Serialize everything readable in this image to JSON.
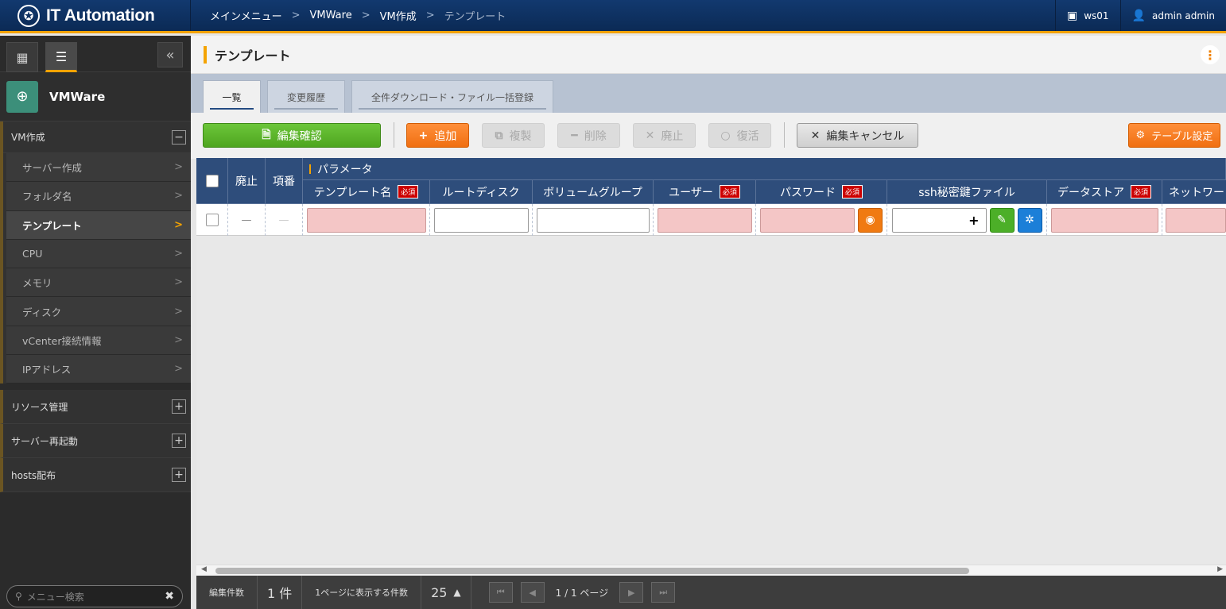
{
  "header": {
    "logo_text": "IT Automation",
    "breadcrumb": [
      "メインメニュー",
      "VMWare",
      "VM作成",
      "テンプレート"
    ],
    "workspace": "ws01",
    "user": "admin admin"
  },
  "sidebar": {
    "menu_title": "VMWare",
    "open_group": {
      "label": "VM作成",
      "items": [
        "サーバー作成",
        "フォルダ名",
        "テンプレート",
        "CPU",
        "メモリ",
        "ディスク",
        "vCenter接続情報",
        "IPアドレス"
      ]
    },
    "collapsed_groups": [
      "リソース管理",
      "サーバー再起動",
      "hosts配布"
    ],
    "search_placeholder": "メニュー検索"
  },
  "page": {
    "title": "テンプレート",
    "tabs": [
      "一覧",
      "変更履歴",
      "全件ダウンロード・ファイル一括登録"
    ]
  },
  "toolbar": {
    "confirm": "編集確認",
    "add": "追加",
    "copy": "複製",
    "delete": "削除",
    "discard": "廃止",
    "restore": "復活",
    "cancel_edit": "編集キャンセル",
    "table_settings": "テーブル設定"
  },
  "table": {
    "col_discard": "廃止",
    "col_no": "項番",
    "group_label": "パラメータ",
    "required_badge": "必須",
    "columns": [
      "テンプレート名",
      "ルートディスク",
      "ボリュームグループ",
      "ユーザー",
      "パスワード",
      "ssh秘密鍵ファイル",
      "データストア",
      "ネットワー"
    ],
    "row_dash": "—"
  },
  "footer": {
    "edit_count_label": "編集件数",
    "edit_count_value": "1 件",
    "per_page_label": "1ページに表示する件数",
    "per_page_value": "25",
    "page_info": "1 / 1 ページ"
  }
}
